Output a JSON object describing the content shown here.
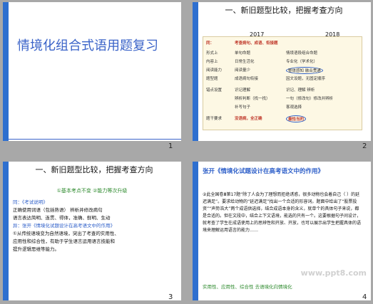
{
  "slides": [
    {
      "number": "1",
      "title": "情境化组合式语用题复习"
    },
    {
      "number": "2",
      "title": "一、新旧题型比较，把握考查方向",
      "years": [
        "2017",
        "2018"
      ],
      "rows": [
        {
          "a": "同：",
          "b": "考查病句、成语、衔接题",
          "c": ""
        },
        {
          "a": "形式上",
          "b": "单句命题",
          "c": "情境语段组合命题"
        },
        {
          "a": "内容上",
          "b": "日常生活化",
          "c": "专业化（学术化）"
        },
        {
          "a": "阅读能力",
          "b": "阅读量少",
          "c": "整体感知   融合贯通"
        },
        {
          "a": "题型题",
          "b": "成语病句衔接",
          "c": "因文设题，无固定顺序"
        },
        {
          "a": "错点设置",
          "b": "识记理解",
          "c": "识记、理解  辨析"
        },
        {
          "a": "",
          "b": "辨析判断（找一找）",
          "c": "一句（修改句）修改并辨析"
        },
        {
          "a": "",
          "b": "补写句子",
          "c": "客观选择"
        },
        {
          "a": "题干要求",
          "b": "没语病，全正确",
          "c": "最恰当的"
        }
      ]
    },
    {
      "number": "3",
      "title": "一、新旧题型比较，把握考查方向",
      "sub": "①基本考点不变    ②能力等次升级",
      "lines": [
        "同：《考试说明》",
        "正确使用词语（包括熟语）  辨析并修改病句",
        "语言表达简明、连贯、得体，准确、鲜明、生动",
        "异：张开《情境化试题设计在高考语文中的作用》",
        "①从传统语境变为自然语境，突出了考查的实用性、",
        "应用性和综合性，有助于学生语言运用语言技能和",
        "提升逻辑思维等能力。"
      ]
    },
    {
      "number": "4",
      "title": "张开《情境化试题设计在高考语文中的作用》",
      "para": "②此全国卷Ⅲ第17题“除了人会为了理想而拒绝诱惑，很多动物也会着自己（ ）的延迟满足”。要求给动物的“延迟满足”找出一个合适的形容词。题面中给出了“股票投资”“声势浩大”两个成语供选择，结合成语本身的含义，就单个的具体句子来说，都是合适的。但在文段中，结合上下文语境，能选的只有一个。这要根据句子间设计，就考查了学生在成语使用上的思辨性和开放、开放，也可以展示出学生把握具体的语境来理解运用语言的能力……",
      "foot": "实用性、应用性、综合性    去语境化向情境化",
      "watermark": "www.ppt8.com"
    }
  ]
}
